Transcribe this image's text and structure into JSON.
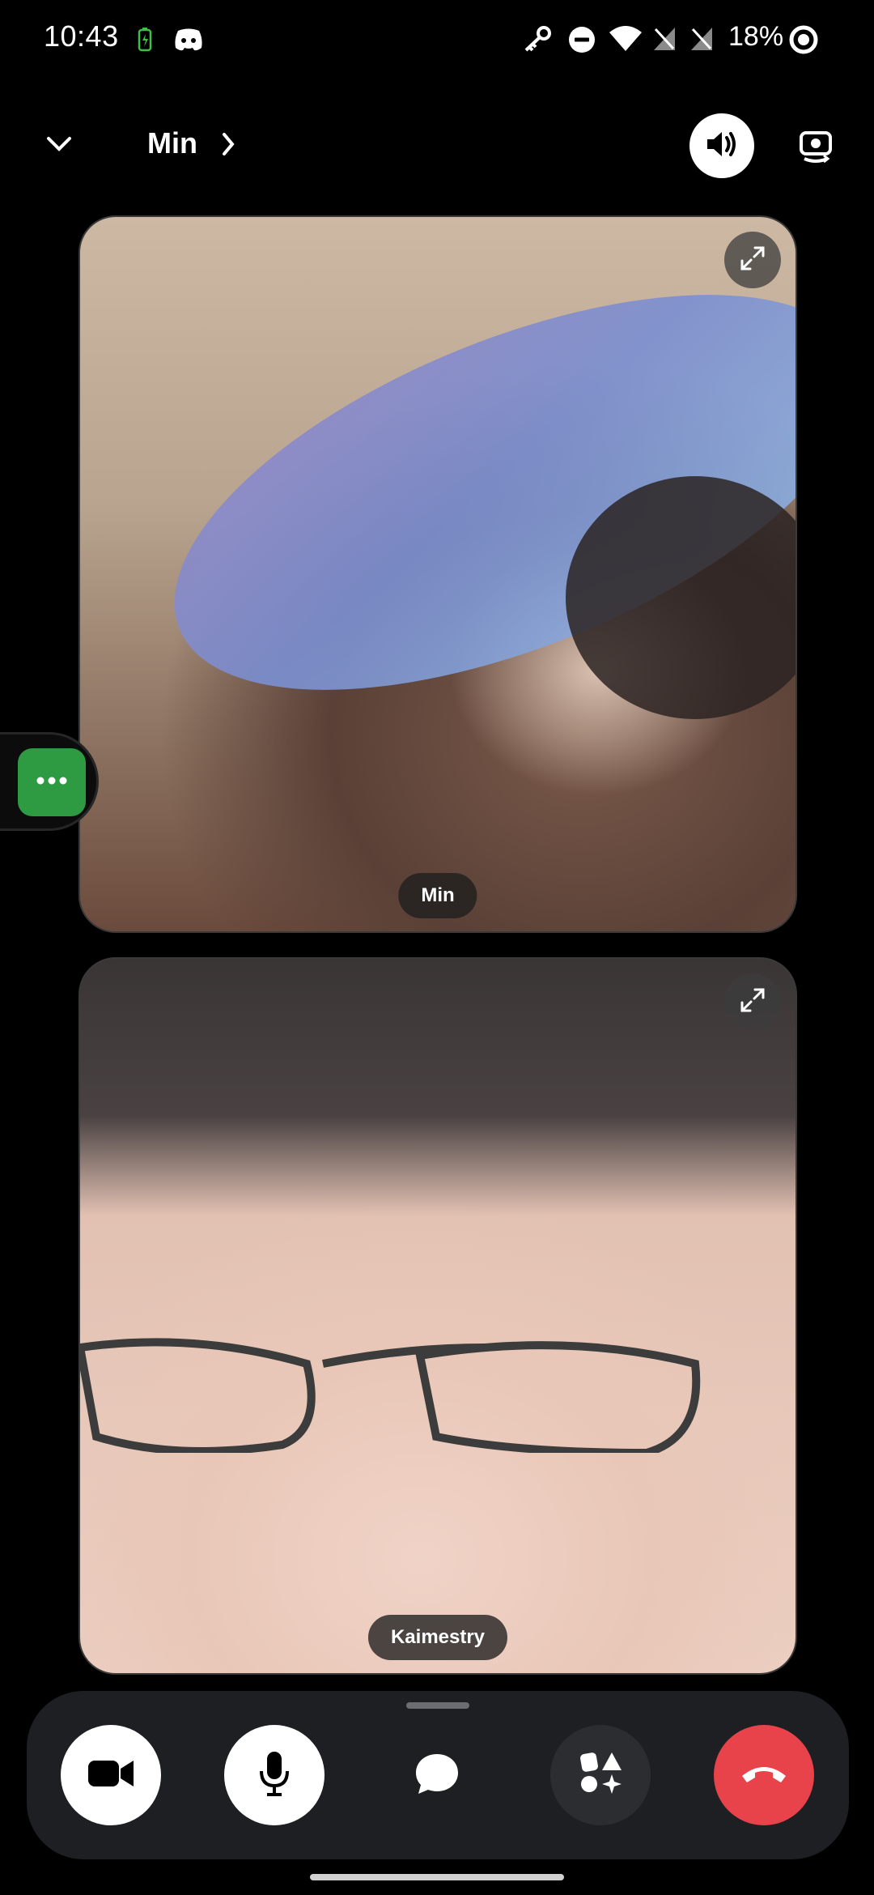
{
  "status_bar": {
    "time": "10:43",
    "battery_percent": "18%",
    "icons": [
      "battery-charging-icon",
      "discord-icon",
      "key-icon",
      "do-not-disturb-icon",
      "wifi-icon",
      "no-sim-icon",
      "no-sim-icon",
      "battery-ring-icon"
    ]
  },
  "header": {
    "title": "Min",
    "icons": [
      "chevron-down-icon",
      "chevron-right-icon",
      "speaker-icon",
      "switch-camera-icon"
    ]
  },
  "participants": [
    {
      "name": "Min"
    },
    {
      "name": "Kaimestry"
    }
  ],
  "controls": {
    "buttons": [
      "video-camera-icon",
      "microphone-icon",
      "chat-bubble-icon",
      "activities-icon",
      "hang-up-icon"
    ]
  },
  "colors": {
    "background": "#000000",
    "dock": "#1e1f22",
    "accent_green": "#2e9b43",
    "hangup_red": "#e8424a"
  }
}
